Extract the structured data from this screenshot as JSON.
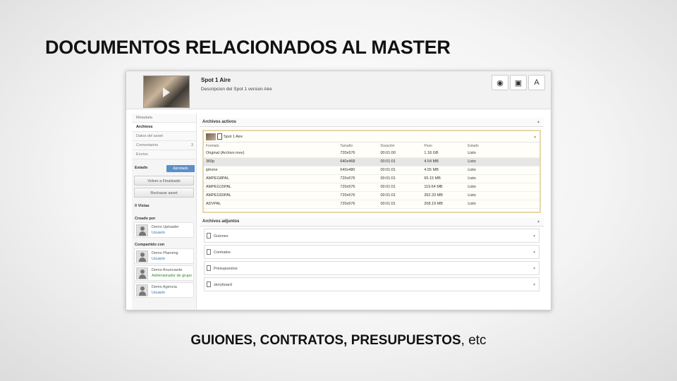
{
  "slide": {
    "title": "DOCUMENTOS RELACIONADOS AL MASTER",
    "footer_bold": "GUIONES, CONTRATOS, PRESUPUESTOS",
    "footer_tail": ", etc"
  },
  "asset": {
    "title": "Spot 1 Aire",
    "description": "Descripcion del Spot 1 version Aire"
  },
  "header_buttons": [
    {
      "icon": "eye-icon",
      "glyph": "◉"
    },
    {
      "icon": "briefcase-icon",
      "glyph": "▣"
    },
    {
      "icon": "broadcast-tower-icon",
      "glyph": "A"
    }
  ],
  "sidebar": {
    "tabs": [
      {
        "label": "Metadata",
        "count": ""
      },
      {
        "label": "Archivos",
        "count": ""
      },
      {
        "label": "Datos del asset",
        "count": ""
      },
      {
        "label": "Comentarios",
        "count": "3"
      },
      {
        "label": "Envíos",
        "count": ""
      }
    ],
    "status_label": "Estado",
    "status_value": "Aprobado",
    "buttons": [
      "Volver a Finalizado",
      "Rechazar asset"
    ],
    "views": "0 Vistas",
    "created_by_label": "Creado por",
    "created_by": [
      {
        "name": "Demo Uploader",
        "role": "Usuario"
      }
    ],
    "shared_with_label": "Compartido con",
    "shared_with": [
      {
        "name": "Demo Planning",
        "role": "Usuario"
      },
      {
        "name": "Demo Anunciante",
        "role": "Administrador de grupo"
      },
      {
        "name": "Demo Agencia",
        "role": "Usuario"
      }
    ]
  },
  "active_files": {
    "heading": "Archivos activos",
    "group_title": "Spot 1 Aire",
    "columns": [
      "Formato",
      "Tamaño",
      "Duración",
      "Peso",
      "Estado"
    ],
    "rows": [
      [
        "Original (Archivo mov)",
        "720x576",
        "00:01:00",
        "1.18 GB",
        "Listo"
      ],
      [
        "360p",
        "640x468",
        "00:01:01",
        "4.54 MB",
        "Listo"
      ],
      [
        "iphone",
        "640x480",
        "00:01:01",
        "4.55 MB",
        "Listo"
      ],
      [
        "AMPEG8PAL",
        "720x576",
        "00:01:01",
        "65.15 MB",
        "Listo"
      ],
      [
        "AMPEG15PAL",
        "720x576",
        "00:01:01",
        "119.64 MB",
        "Listo"
      ],
      [
        "AMPEG50PAL",
        "720x576",
        "00:01:01",
        "392.33 MB",
        "Listo"
      ],
      [
        "ADVPAL",
        "720x576",
        "00:01:01",
        "208.19 MB",
        "Listo"
      ]
    ],
    "highlighted_row": 1
  },
  "attached_files": {
    "heading": "Archivos adjuntos",
    "items": [
      "Guiones",
      "Contratos",
      "Presupuestos",
      "storyboard"
    ]
  }
}
